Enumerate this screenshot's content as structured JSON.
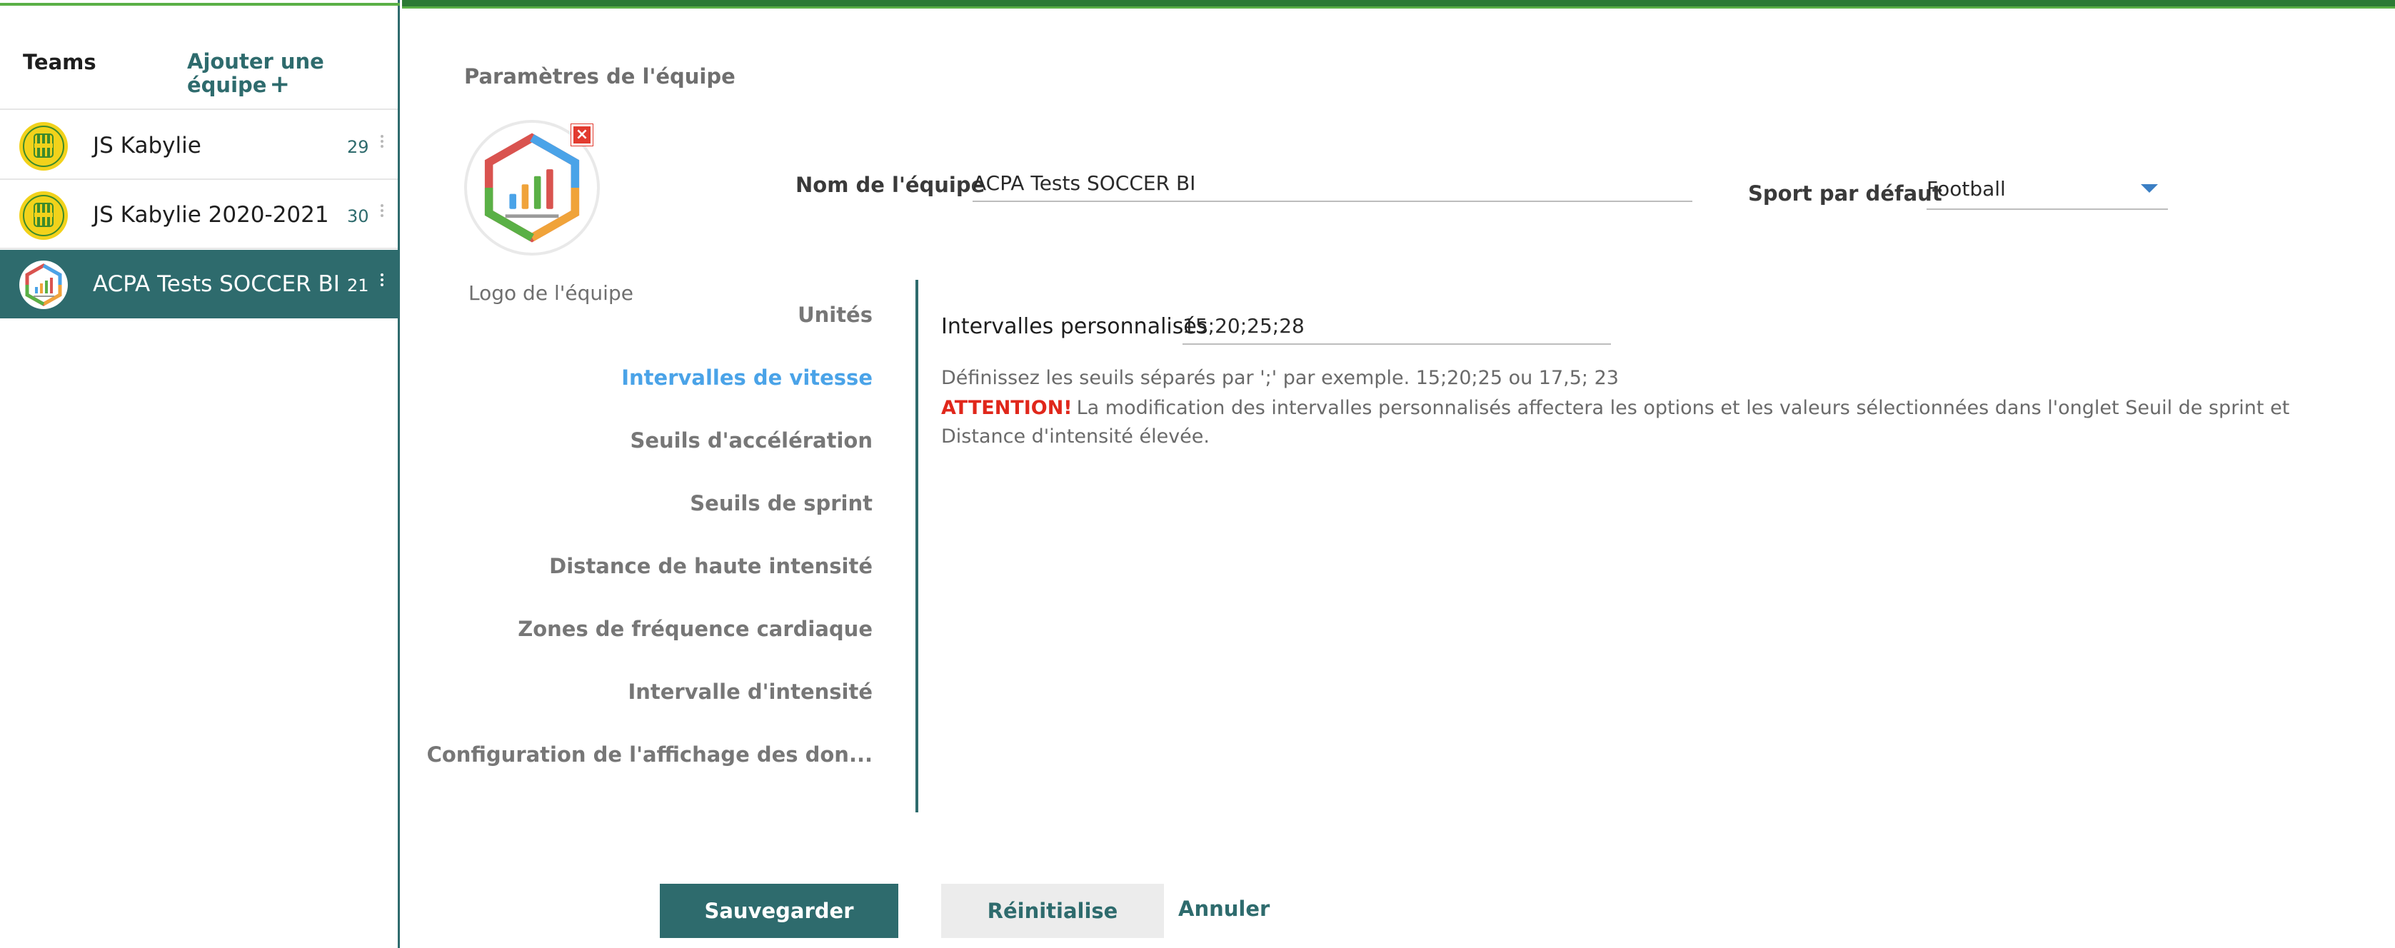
{
  "sidebar": {
    "title": "Teams",
    "add_team_label": "Ajouter une équipe",
    "add_team_icon": "plus-icon",
    "teams": [
      {
        "name": "JS Kabylie",
        "count": "29",
        "selected": false
      },
      {
        "name": "JS Kabylie 2020-2021",
        "count": "30",
        "selected": false
      },
      {
        "name": "ACPA Tests SOCCER BI",
        "count": "21",
        "selected": true
      }
    ]
  },
  "main": {
    "page_title": "Paramètres de l'équipe",
    "logo_caption": "Logo de l'équipe",
    "team_name_label": "Nom de l'équipe",
    "team_name_value": "ACPA Tests SOCCER BI",
    "default_sport_label": "Sport par défaut",
    "default_sport_value": "Football",
    "nav": [
      {
        "label": "Unités",
        "active": false
      },
      {
        "label": "Intervalles de vitesse",
        "active": true
      },
      {
        "label": "Seuils d'accélération",
        "active": false
      },
      {
        "label": "Seuils de sprint",
        "active": false
      },
      {
        "label": "Distance de haute intensité",
        "active": false
      },
      {
        "label": "Zones de fréquence cardiaque",
        "active": false
      },
      {
        "label": "Intervalle d'intensité",
        "active": false
      },
      {
        "label": "Configuration de l'affichage des don...",
        "active": false
      }
    ],
    "custom_intervals_label": "Intervalles personnalisés",
    "custom_intervals_value": "15;20;25;28",
    "help_text": "Définissez les seuils séparés par ';' par exemple. 15;20;25 ou 17,5; 23",
    "attention_label": "ATTENTION!",
    "attention_text": "La modification des intervalles personnalisés affectera les options et les valeurs sélectionnées dans l'onglet Seuil de sprint et Distance d'intensité élevée."
  },
  "actions": {
    "save_label": "Sauvegarder",
    "reset_label": "Réinitialise",
    "cancel_label": "Annuler"
  },
  "colors": {
    "brand_teal": "#2e6b6d",
    "active_nav": "#4aa3e8",
    "warning_red": "#e0271b",
    "top_green": "#5ab046"
  }
}
